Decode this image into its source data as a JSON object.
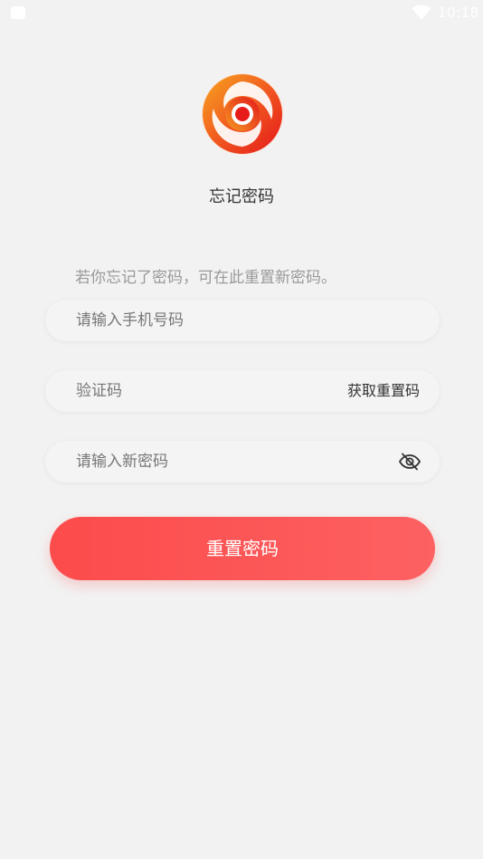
{
  "status_bar": {
    "time": "10:18",
    "icons": [
      "notification-icon",
      "wifi-icon"
    ]
  },
  "logo": {
    "icon": "app-logo-swirl",
    "colors": [
      "#f5a020",
      "#f0451f",
      "#e3121a"
    ]
  },
  "page": {
    "title": "忘记密码",
    "hint": "若你忘记了密码，可在此重置新密码。"
  },
  "form": {
    "phone": {
      "value": "",
      "placeholder": "请输入手机号码"
    },
    "code": {
      "value": "",
      "placeholder": "验证码",
      "get_code_label": "获取重置码"
    },
    "password": {
      "value": "",
      "placeholder": "请输入新密码",
      "toggle_icon": "eye-off-icon"
    },
    "submit_label": "重置密码"
  },
  "colors": {
    "background": "#f2f2f2",
    "accent": "#fc4b4b",
    "accent_light": "#fd6162",
    "hint_text": "#999999"
  }
}
